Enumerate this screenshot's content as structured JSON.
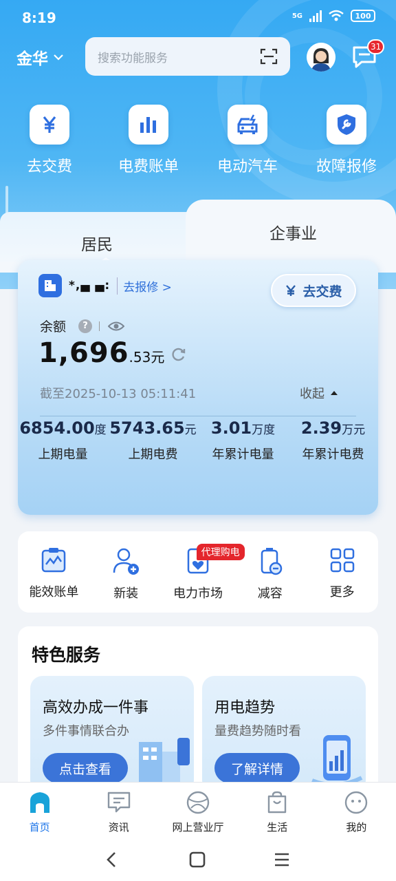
{
  "status": {
    "time": "8:19",
    "network": "5G",
    "battery": "100"
  },
  "header": {
    "city": "金华",
    "search_placeholder": "搜索功能服务",
    "message_count": "31"
  },
  "quick_actions": [
    {
      "label": "去交费",
      "icon": "yuan-icon"
    },
    {
      "label": "电费账单",
      "icon": "bar-chart-icon"
    },
    {
      "label": "电动汽车",
      "icon": "ev-car-icon"
    },
    {
      "label": "故障报修",
      "icon": "repair-shield-icon"
    }
  ],
  "tabs": {
    "residential": "居民",
    "enterprise": "企事业"
  },
  "account": {
    "number_masked": "*,▄ ▄:",
    "repair_link": "去报修 >",
    "pay_button": "去交费",
    "balance_label": "余额",
    "balance_int": "1,696",
    "balance_dec": ".53元",
    "as_of": "截至2025-10-13 05:11:41",
    "collapse": "收起",
    "stats": [
      {
        "value": "6854.00",
        "unit": "度",
        "label": "上期电量"
      },
      {
        "value": "5743.65",
        "unit": "元",
        "label": "上期电费"
      },
      {
        "value": "3.01",
        "unit": "万度",
        "label": "年累计电量"
      },
      {
        "value": "2.39",
        "unit": "万元",
        "label": "年累计电费"
      }
    ]
  },
  "services": [
    {
      "label": "能效账单",
      "icon": "efficiency-bill-icon"
    },
    {
      "label": "新装",
      "icon": "new-install-icon"
    },
    {
      "label": "电力市场",
      "icon": "power-market-icon",
      "tag": "代理购电"
    },
    {
      "label": "减容",
      "icon": "reduce-capacity-icon"
    },
    {
      "label": "更多",
      "icon": "grid-more-icon"
    }
  ],
  "featured": {
    "title": "特色服务",
    "cards": [
      {
        "title": "高效办成一件事",
        "subtitle": "多件事情联合办",
        "button": "点击查看"
      },
      {
        "title": "用电趋势",
        "subtitle": "量费趋势随时看",
        "button": "了解详情"
      }
    ]
  },
  "bottom_nav": [
    {
      "label": "首页",
      "active": true
    },
    {
      "label": "资讯"
    },
    {
      "label": "网上营业厅"
    },
    {
      "label": "生活"
    },
    {
      "label": "我的"
    }
  ],
  "colors": {
    "primary": "#1a73e8",
    "hero": "#35a9f3",
    "badge": "#e7282f",
    "button": "#3b74d8"
  }
}
